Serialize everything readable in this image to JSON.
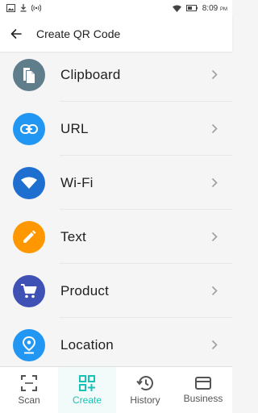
{
  "status_bar": {
    "time": "8:09",
    "ampm": "PM"
  },
  "toolbar": {
    "title": "Create QR Code"
  },
  "list": {
    "items": [
      {
        "label": "Clipboard",
        "icon": "clipboard-icon",
        "color": "#5f7d8a"
      },
      {
        "label": "URL",
        "icon": "link-icon",
        "color": "#2196f3"
      },
      {
        "label": "Wi-Fi",
        "icon": "wifi-icon",
        "color": "#1e6fd0"
      },
      {
        "label": "Text",
        "icon": "pencil-icon",
        "color": "#ff9800"
      },
      {
        "label": "Product",
        "icon": "cart-icon",
        "color": "#3f51b5"
      },
      {
        "label": "Location",
        "icon": "location-icon",
        "color": "#2196f3"
      }
    ]
  },
  "bottom_nav": {
    "items": [
      {
        "label": "Scan",
        "icon": "scan-icon"
      },
      {
        "label": "Create",
        "icon": "create-qr-icon",
        "active": true
      },
      {
        "label": "History",
        "icon": "history-icon"
      },
      {
        "label": "Business",
        "icon": "business-card-icon"
      }
    ]
  },
  "colors": {
    "accent": "#17c3b5"
  }
}
